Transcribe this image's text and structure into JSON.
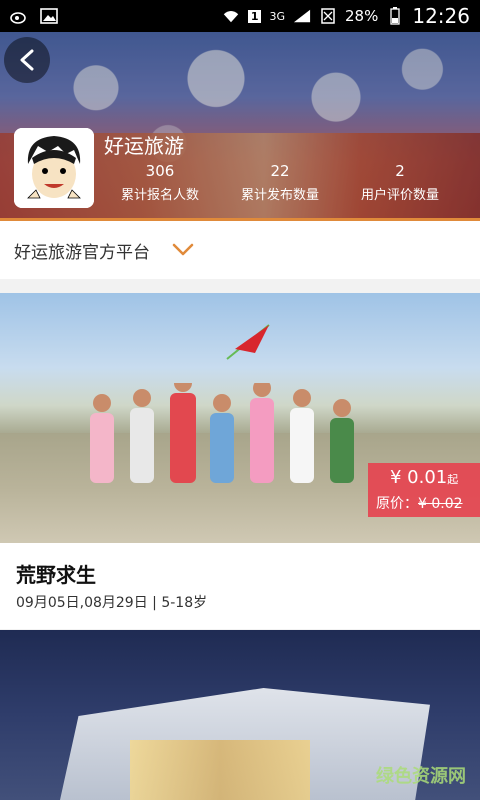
{
  "status_bar": {
    "network": "3G",
    "sim": "1",
    "battery": "28%",
    "time": "12:26"
  },
  "header": {
    "org_name": "好运旅游",
    "stats": [
      {
        "num": "306",
        "label": "累计报名人数"
      },
      {
        "num": "22",
        "label": "累计发布数量"
      },
      {
        "num": "2",
        "label": "用户评价数量"
      }
    ]
  },
  "platform": {
    "label": "好运旅游官方平台"
  },
  "trip": {
    "price": "¥ 0.01",
    "price_suffix": "起",
    "orig_prefix": "原价：",
    "orig_price": "¥ 0.02",
    "title": "荒野求生",
    "meta": "09月05日,08月29日   | 5-18岁"
  },
  "watermark": "绿色资源网",
  "colors": {
    "accent": "#e08a3a",
    "badge": "#e54450"
  }
}
